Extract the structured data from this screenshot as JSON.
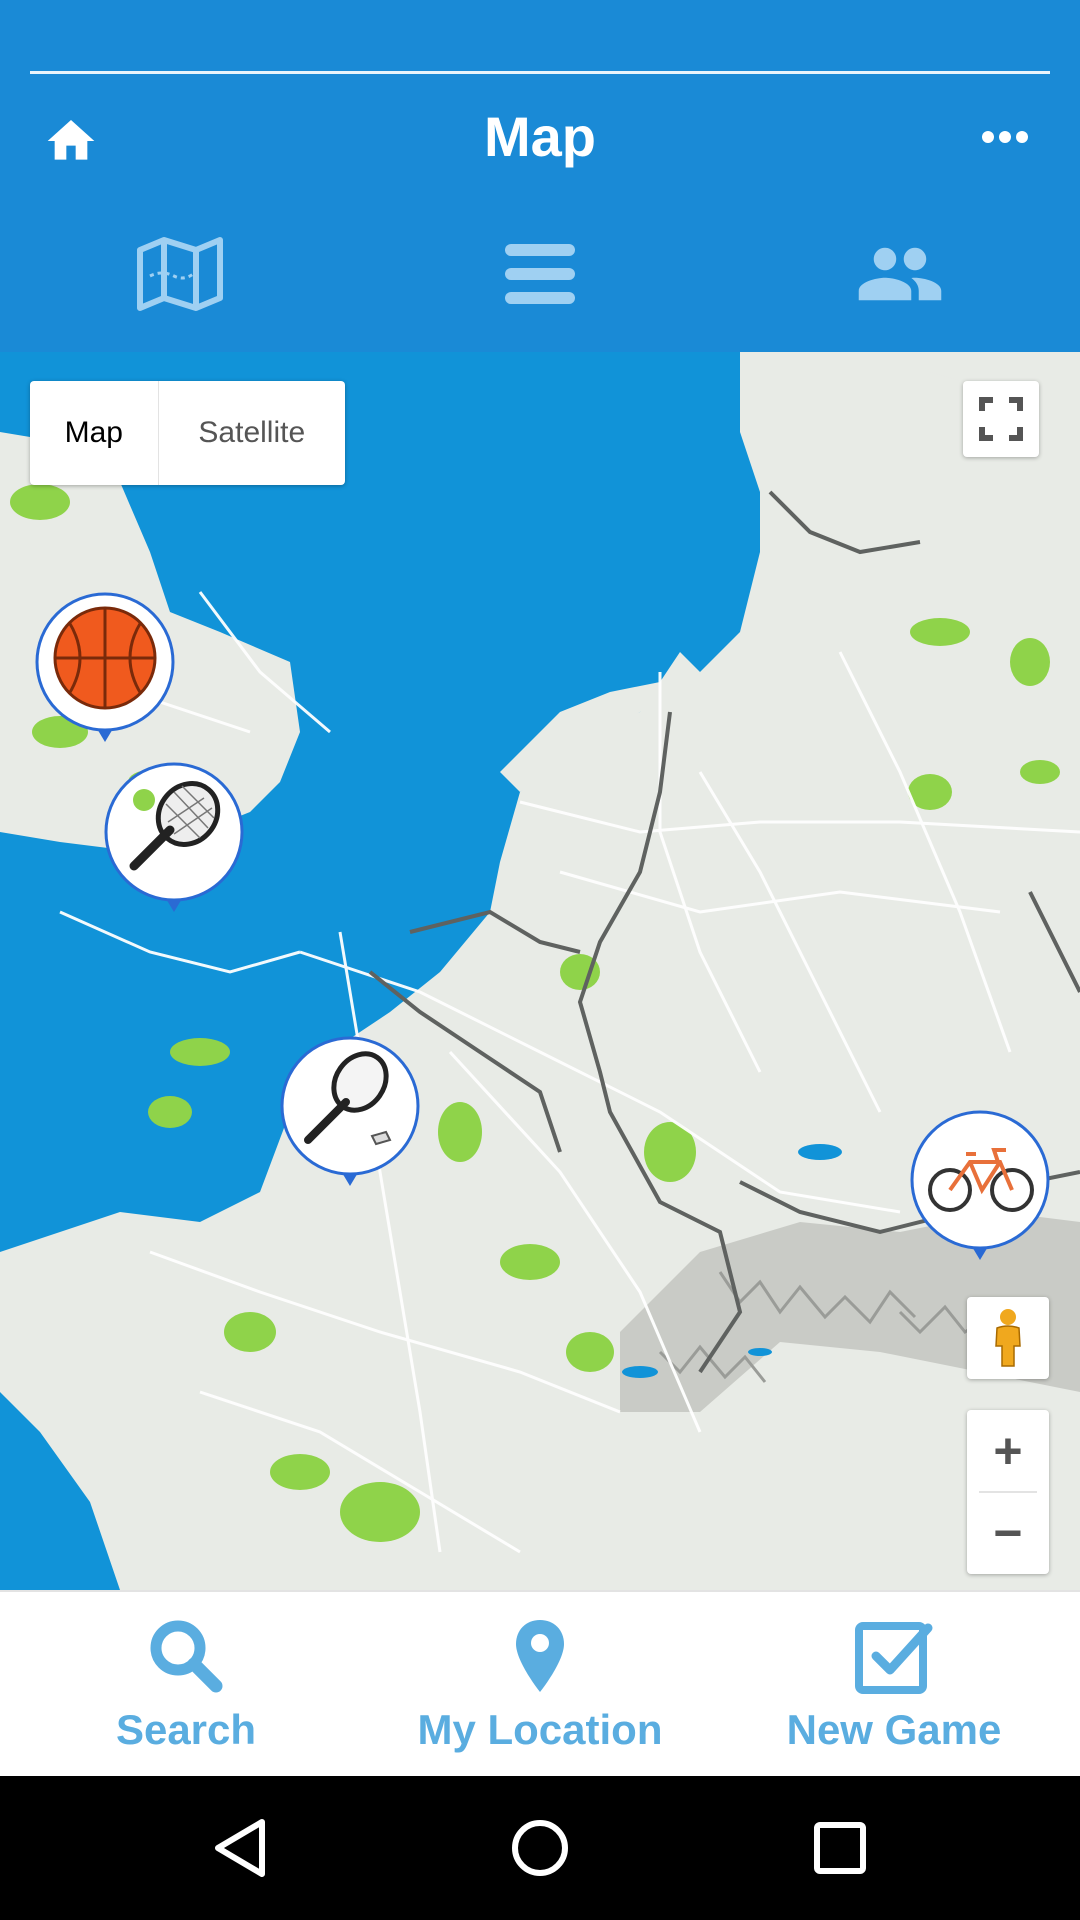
{
  "header": {
    "title": "Map",
    "home_icon": "home-icon",
    "more_icon": "more-horizontal-icon",
    "tabs": [
      {
        "icon": "map-icon",
        "selected": true
      },
      {
        "icon": "list-icon",
        "selected": false
      },
      {
        "icon": "people-icon",
        "selected": false
      }
    ]
  },
  "map": {
    "type_control": {
      "map_label": "Map",
      "satellite_label": "Satellite",
      "selected": "Map"
    },
    "fullscreen_icon": "fullscreen-icon",
    "pegman_icon": "street-view-pegman-icon",
    "zoom_in_label": "+",
    "zoom_out_label": "−",
    "markers": [
      {
        "sport": "basketball",
        "icon": "basketball-icon"
      },
      {
        "sport": "tennis",
        "icon": "tennis-racket-ball-icon"
      },
      {
        "sport": "badminton",
        "icon": "badminton-racket-icon"
      },
      {
        "sport": "cycling",
        "icon": "bicycle-icon"
      }
    ]
  },
  "bottom_nav": {
    "search": {
      "label": "Search",
      "icon": "search-icon"
    },
    "location": {
      "label": "My Location",
      "icon": "location-pin-icon"
    },
    "new_game": {
      "label": "New Game",
      "icon": "checkbox-icon"
    }
  },
  "colors": {
    "header": "#1a8ad6",
    "nav_text": "#5aade0",
    "sea": "#1193d8",
    "land": "#e8ebe6",
    "marker_tip": "#2a6ad4"
  }
}
